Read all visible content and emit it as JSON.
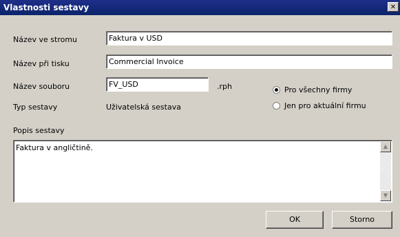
{
  "window": {
    "title": "Vlastnosti sestavy"
  },
  "labels": {
    "tree_name": "Název ve stromu",
    "print_name": "Název při tisku",
    "file_name": "Název souboru",
    "report_type": "Typ sestavy",
    "description": "Popis sestavy"
  },
  "values": {
    "tree_name": "Faktura v USD",
    "print_name": "Commercial Invoice",
    "file_name": "FV_USD",
    "file_ext": ".rph",
    "report_type": "Uživatelská sestava",
    "description": "Faktura v angličtině."
  },
  "scope": {
    "options": [
      {
        "label": "Pro všechny firmy",
        "checked": true
      },
      {
        "label": "Jen pro aktuální firmu",
        "checked": false
      }
    ]
  },
  "buttons": {
    "ok": "OK",
    "cancel": "Storno"
  },
  "icons": {
    "close": "close-icon",
    "scroll_up": "arrow-up-icon",
    "scroll_down": "arrow-down-icon"
  }
}
